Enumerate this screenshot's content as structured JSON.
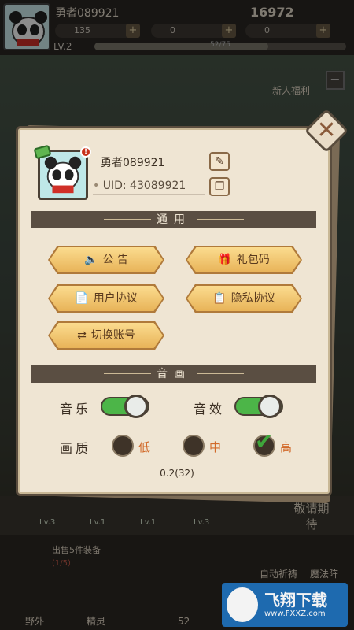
{
  "topbar": {
    "player_name": "勇者089921",
    "score": "16972",
    "resources": [
      "135",
      "0",
      "0"
    ],
    "level": "LV.2",
    "xp_text": "52/75",
    "xp_fraction": 0.69
  },
  "background": {
    "new_welfare": "新人福利",
    "task_title": "出售5件装备",
    "task_progress": "(1/5)",
    "auto_pray": "自动祈祷",
    "magic_array": "魔法阵",
    "wild": "野外",
    "spirit": "精灵",
    "count": "52",
    "slot_levels": [
      "Lv.3",
      "Lv.1",
      "Lv.1",
      "Lv.3"
    ],
    "coming_soon": "敬请期待"
  },
  "profile": {
    "name": "勇者089921",
    "uid": "UID: 43089921"
  },
  "sections": {
    "general": "通用",
    "audio_video": "音画"
  },
  "buttons": {
    "announcement": "公 告",
    "gift_code": "礼包码",
    "user_agreement": "用户协议",
    "privacy_agreement": "隐私协议",
    "switch_account": "切换账号"
  },
  "settings": {
    "music_label": "音乐",
    "sfx_label": "音效",
    "quality_label": "画质",
    "music_on": true,
    "sfx_on": true,
    "quality_options": [
      "低",
      "中",
      "高"
    ],
    "quality_selected": "高"
  },
  "version": "0.2(32)",
  "watermark": {
    "title": "飞翔下载",
    "url": "www.FXXZ.com"
  }
}
